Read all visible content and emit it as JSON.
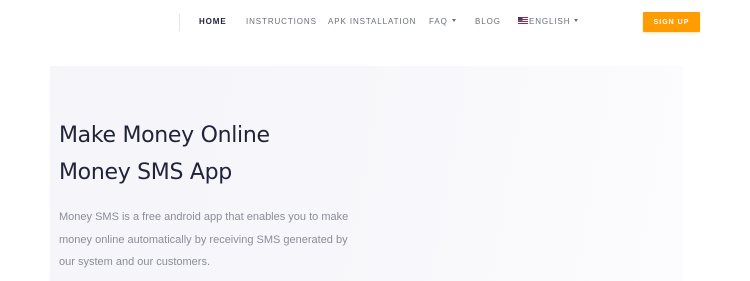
{
  "nav": {
    "items": [
      {
        "label": "HOME",
        "active": true
      },
      {
        "label": "INSTRUCTIONS"
      },
      {
        "label": "APK INSTALLATION"
      },
      {
        "label": "FAQ",
        "dropdown": true
      },
      {
        "label": "BLOG"
      },
      {
        "label": "ENGLISH",
        "dropdown": true,
        "icon": "us-flag-icon"
      }
    ],
    "signup_label": "SIGN UP"
  },
  "hero": {
    "title_line1": "Make Money Online",
    "title_line2": "Money SMS App",
    "description": "Money SMS is a free android app that enables you to make money online automatically by receiving SMS generated by our system and our customers."
  },
  "colors": {
    "accent": "#ff9c00",
    "heading": "#21233a",
    "nav_text": "#6b6f7b",
    "body_text": "#8a8d98",
    "hero_bg": "#f7f7fb"
  }
}
